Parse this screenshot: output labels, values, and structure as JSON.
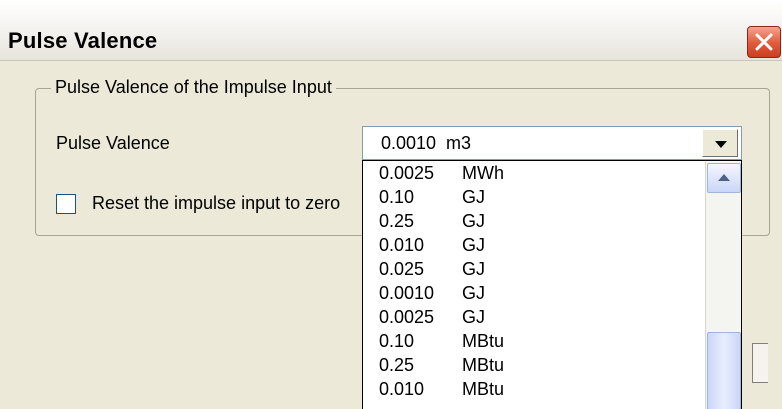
{
  "window": {
    "title": "Pulse Valence"
  },
  "group": {
    "legend": "Pulse Valence of the Impulse Input",
    "pulse_valence_label": "Pulse Valence",
    "selected_value": "0.0010  m3",
    "reset_checkbox_label": "Reset the impulse input to zero",
    "reset_checked": false
  },
  "dropdown": {
    "items": [
      {
        "value": "0.0025",
        "unit": "MWh"
      },
      {
        "value": "0.10",
        "unit": "GJ"
      },
      {
        "value": "0.25",
        "unit": "GJ"
      },
      {
        "value": "0.010",
        "unit": "GJ"
      },
      {
        "value": "0.025",
        "unit": "GJ"
      },
      {
        "value": "0.0010",
        "unit": "GJ"
      },
      {
        "value": "0.0025",
        "unit": "GJ"
      },
      {
        "value": "0.10",
        "unit": "MBtu"
      },
      {
        "value": "0.25",
        "unit": "MBtu"
      },
      {
        "value": "0.010",
        "unit": "MBtu"
      }
    ]
  }
}
